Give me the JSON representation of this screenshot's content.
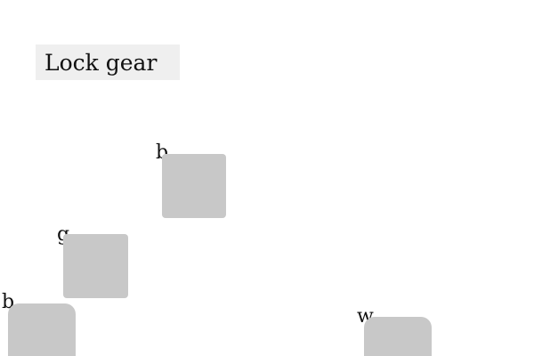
{
  "header": {
    "title": "Lock gear"
  },
  "tiles": [
    {
      "label": "b"
    },
    {
      "label": "g"
    },
    {
      "label": "b"
    },
    {
      "label": "w"
    }
  ],
  "colors": {
    "background": "#ffffff",
    "title_bar": "#efefef",
    "tile": "#c8c8c8",
    "text": "#111111"
  }
}
